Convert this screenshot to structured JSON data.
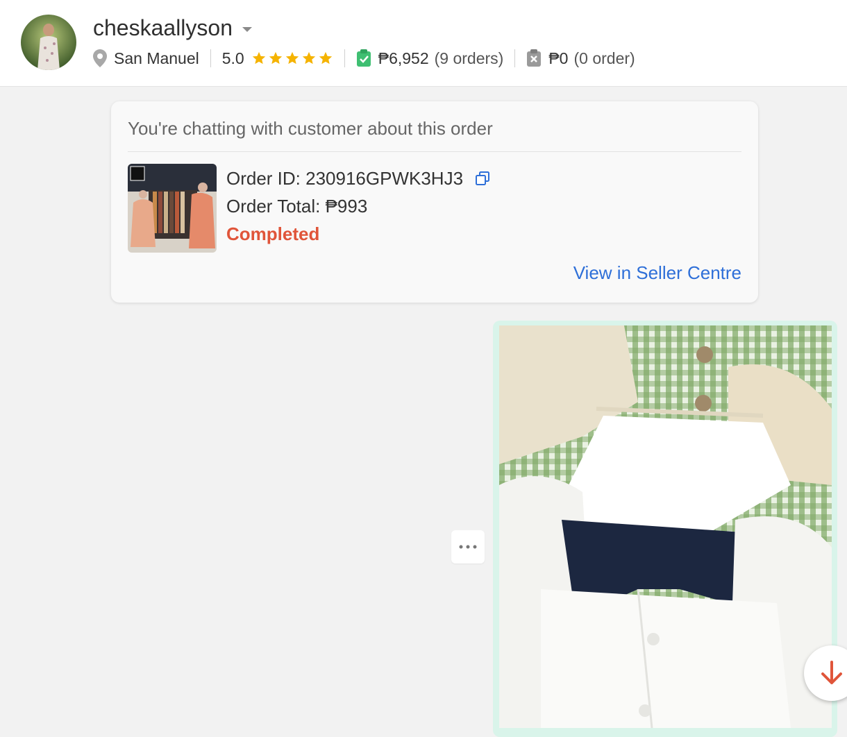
{
  "header": {
    "username": "cheskaallyson",
    "location": "San Manuel",
    "rating": "5.0",
    "stars": 5,
    "completed_amount": "₱6,952",
    "completed_orders": "(9 orders)",
    "cancelled_amount": "₱0",
    "cancelled_orders": "(0 order)"
  },
  "order_card": {
    "title": "You're chatting with customer about this order",
    "order_id_label": "Order ID: 230916GPWK3HJ3",
    "order_total_label": "Order Total: ₱993",
    "status": "Completed",
    "view_link": "View in Seller Centre"
  },
  "colors": {
    "status": "#e0553a",
    "link": "#2e6fd8",
    "star": "#f5b301",
    "bubble": "#d9f4ea",
    "completed_icon": "#3fbf72"
  },
  "icons": {
    "location": "location-pin-icon",
    "completed": "clipboard-check-icon",
    "cancelled": "clipboard-x-icon",
    "copy": "copy-icon",
    "more": "more-dots-icon",
    "scroll": "arrow-down-icon"
  }
}
